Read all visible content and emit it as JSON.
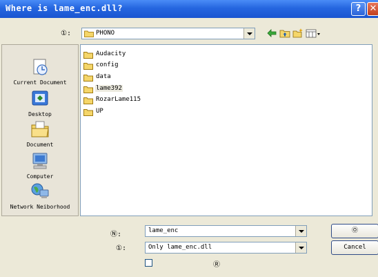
{
  "window": {
    "title": "Where is lame_enc.dll?"
  },
  "lookin": {
    "label": "①:",
    "value": "PHONO"
  },
  "places": [
    {
      "label": "Current Document",
      "icon": "recent-documents-icon"
    },
    {
      "label": "Desktop",
      "icon": "desktop-icon"
    },
    {
      "label": "Document",
      "icon": "my-documents-icon"
    },
    {
      "label": "Computer",
      "icon": "computer-icon"
    },
    {
      "label": "Network Neiborhood",
      "icon": "network-icon"
    }
  ],
  "files": [
    "Audacity",
    "config",
    "data",
    "lame392",
    "RozarLame115",
    "UP"
  ],
  "filename": {
    "label": "Ⓝ:",
    "value": "lame_enc"
  },
  "filetype": {
    "label": "①:",
    "value": "Only lame_enc.dll"
  },
  "readonly_label": "Ⓡ",
  "buttons": {
    "open": "Ⓞ",
    "cancel": "Cancel"
  },
  "colors": {
    "titlebar": "#2566e0",
    "folder": "#f5d66a",
    "selection": "#eceadf"
  }
}
